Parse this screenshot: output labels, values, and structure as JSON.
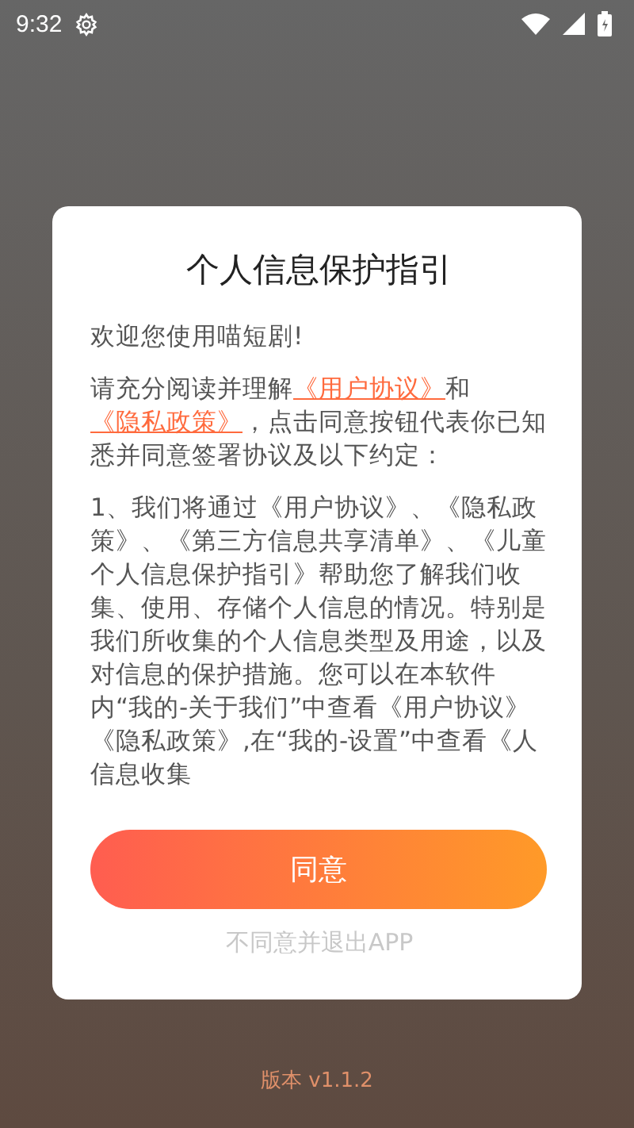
{
  "status_bar": {
    "time": "9:32"
  },
  "dialog": {
    "title": "个人信息保护指引",
    "welcome": "欢迎您使用喵短剧!",
    "consent": [
      {
        "kind": "text",
        "text": "请充分阅读并理解"
      },
      {
        "kind": "link",
        "text": "《用户协议》"
      },
      {
        "kind": "text",
        "text": "和"
      },
      {
        "kind": "link",
        "text": "《隐私政策》"
      },
      {
        "kind": "text",
        "text": "，点击同意按钮代表你已知悉并同意签署协议及以下约定："
      }
    ],
    "terms": "1、我们将通过《用户协议》、《隐私政策》、《第三方信息共享清单》、《儿童个人信息保护指引》帮助您了解我们收集、使用、存储个人信息的情况。特别是我们所收集的个人信息类型及用途，以及对信息的保护措施。您可以在本软件内“我的-关于我们”中查看《用户协议》《隐私政策》,在“我的-设置”中查看《人信息收集",
    "agree_button": "同意",
    "decline_link": "不同意并退出APP"
  },
  "version": "版本 v1.1.2"
}
